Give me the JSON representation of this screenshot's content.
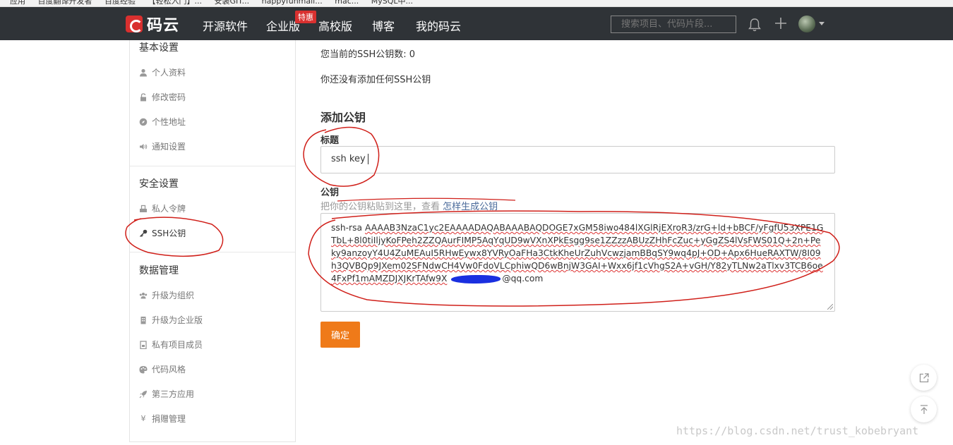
{
  "browser": {
    "bookmarks": [
      "应用",
      "百度翻译开发者",
      "百度经验",
      "【轻松入门】...",
      "安装GIT...",
      "happyfunmall...",
      "mac...",
      "MySQL中..."
    ]
  },
  "nav": {
    "logo_text": "码云",
    "items": [
      "开源软件",
      "企业版",
      "高校版",
      "博客",
      "我的码云"
    ],
    "enterprise_badge": "特惠",
    "search_placeholder": "搜索项目、代码片段..."
  },
  "sidebar": {
    "basic_title": "基本设置",
    "basic_items": [
      {
        "label": "个人资料",
        "icon": "user-icon"
      },
      {
        "label": "修改密码",
        "icon": "lock-icon"
      },
      {
        "label": "个性地址",
        "icon": "compass-icon"
      },
      {
        "label": "通知设置",
        "icon": "volume-icon"
      }
    ],
    "security_title": "安全设置",
    "security_items": [
      {
        "label": "私人令牌",
        "icon": "token-icon"
      },
      {
        "label": "SSH公钥",
        "icon": "key-icon"
      }
    ],
    "data_title": "数据管理",
    "data_items": [
      {
        "label": "升级为组织",
        "icon": "users-icon"
      },
      {
        "label": "升级为企业版",
        "icon": "building-icon"
      },
      {
        "label": "私有项目成员",
        "icon": "member-icon"
      },
      {
        "label": "代码风格",
        "icon": "palette-icon"
      },
      {
        "label": "第三方应用",
        "icon": "rocket-icon"
      },
      {
        "label": "捐赠管理",
        "icon": "yen-icon"
      }
    ]
  },
  "main": {
    "key_count": "您当前的SSH公钥数: 0",
    "no_key": "你还没有添加任何SSH公钥",
    "add_heading": "添加公钥",
    "title_label": "标题",
    "title_value": "ssh key",
    "key_label": "公钥",
    "hint_text": "把你的公钥粘贴到这里，查看 ",
    "hint_link": "怎样生成公钥",
    "key_prefix": "ssh-rsa",
    "key_body": "AAAAB3NzaC1yc2EAAAADAQABAAABAQDOGE7xGM58iwo484lXGlRjEXroR3/zrG+ld+bBCF/yFgfU53XPE1GTbL+8l0tiIljyKoFPeh2ZZQAurFIMP5AqYqUD9wVXnXPkEsgg9se1ZZzzABUzZHhFcZuc+yGgZS4lVsFWS01Q+2n+Peky9anzoyY4U4ZuMEAuI5RHwEywx8YVRyOaFHa3CtkKheUrZuhVcwzjamBBqSY9wq4pJ+OD+Apx6HueRAXTW/8I09h3QVBQp9JXem02SFNdwCH4Vw0FdoVLCphiwQD6wBnjW3GAI+Wxx6jf1cVhgS2A+vGH/Y82yTLNw2aTlxv3TCB6oe4FxPf1mAMZDJXJKrTAfw9X",
    "key_email_suffix": "@qq.com",
    "confirm_label": "确定"
  },
  "watermark": "https://blog.csdn.net/trust_kobebryant",
  "colors": {
    "nav_bg": "#2f3337",
    "brand_red": "#d9302f",
    "confirm_orange": "#ef7a19",
    "annotation_red": "#d0201a",
    "redaction_blue": "#1a2fe0"
  }
}
